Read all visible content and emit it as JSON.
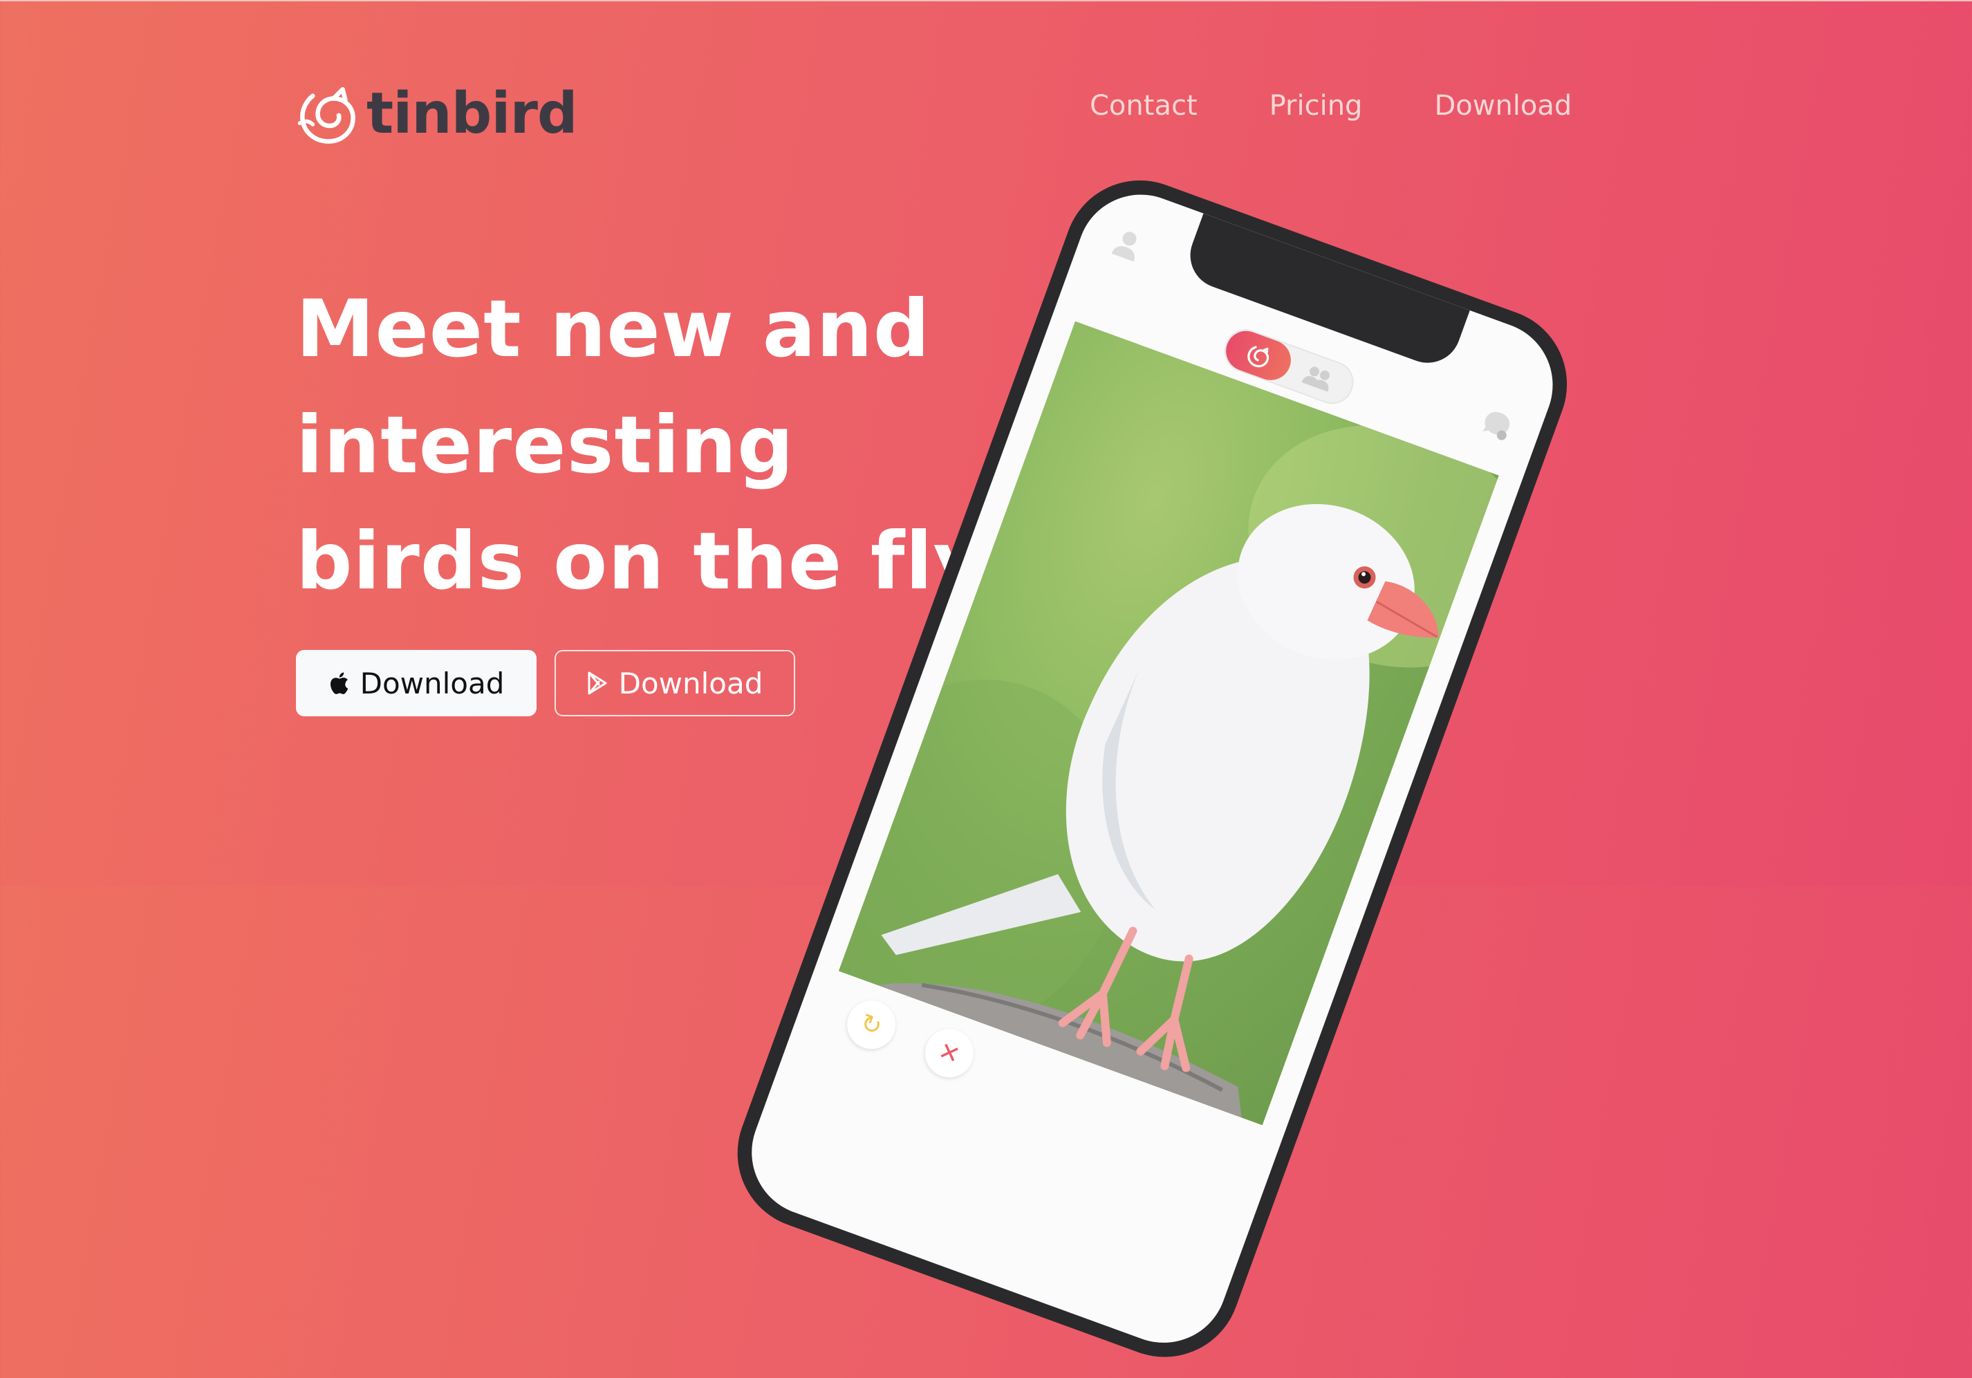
{
  "brand": {
    "name": "tinbird"
  },
  "nav": {
    "items": [
      {
        "label": "Contact"
      },
      {
        "label": "Pricing"
      },
      {
        "label": "Download"
      }
    ]
  },
  "hero": {
    "headline_lines": [
      "Meet new and",
      "interesting",
      "birds on the fly."
    ],
    "buttons": {
      "ios": {
        "label": "Download",
        "icon": "apple-icon"
      },
      "android": {
        "label": "Download",
        "icon": "play-store-icon"
      }
    }
  },
  "phone": {
    "toggle_state": "birds",
    "icons": [
      "profile-icon",
      "chat-icon",
      "undo-icon",
      "dislike-icon"
    ]
  },
  "colors": {
    "gradient_start": "#ee7060",
    "gradient_end": "#e84a6b",
    "logo_text": "#3e3a44",
    "nav_text": "#f6d7d4",
    "primary_button_bg": "#f8f9fb"
  }
}
